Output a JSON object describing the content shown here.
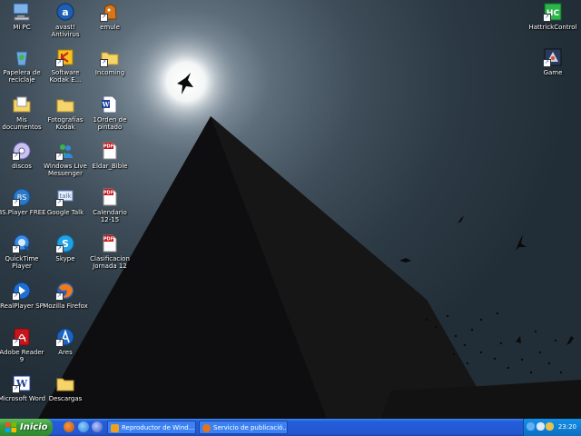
{
  "desktop": {
    "icons": [
      {
        "label": "Mi PC"
      },
      {
        "label": "Papelera de\nreciclaje"
      },
      {
        "label": "Mis\ndocumentos"
      },
      {
        "label": "discos"
      },
      {
        "label": "BS.Player FREE"
      },
      {
        "label": "QuickTime\nPlayer"
      },
      {
        "label": "RealPlayer SP"
      },
      {
        "label": "Adobe Reader\n9"
      },
      {
        "label": "Microsoft Word"
      },
      {
        "label": "avast!\nAntivirus"
      },
      {
        "label": "Software\nKodak E..."
      },
      {
        "label": "Fotografías\nKodak"
      },
      {
        "label": "Windows Live\nMessenger"
      },
      {
        "label": "Google Talk"
      },
      {
        "label": "Skype"
      },
      {
        "label": "Mozilla Firefox"
      },
      {
        "label": "Ares"
      },
      {
        "label": "Descargas"
      },
      {
        "label": "emule"
      },
      {
        "label": "Incoming"
      },
      {
        "label": "1Orden de\npintado"
      },
      {
        "label": "Eldar_Bible"
      },
      {
        "label": "Calendario\n12-15"
      },
      {
        "label": "Clasificacion\nJornada 12"
      },
      {
        "label": "HattrickControl"
      },
      {
        "label": "Game"
      }
    ]
  },
  "taskbar": {
    "start_label": "Inicio",
    "tasks": [
      {
        "label": "Reproductor de Wind..."
      },
      {
        "label": "Servicio de publicació..."
      }
    ],
    "clock": "23:20"
  },
  "colors": {
    "taskbar": "#245edb",
    "start": "#3c9a3c",
    "tray": "#0f7ed6"
  }
}
